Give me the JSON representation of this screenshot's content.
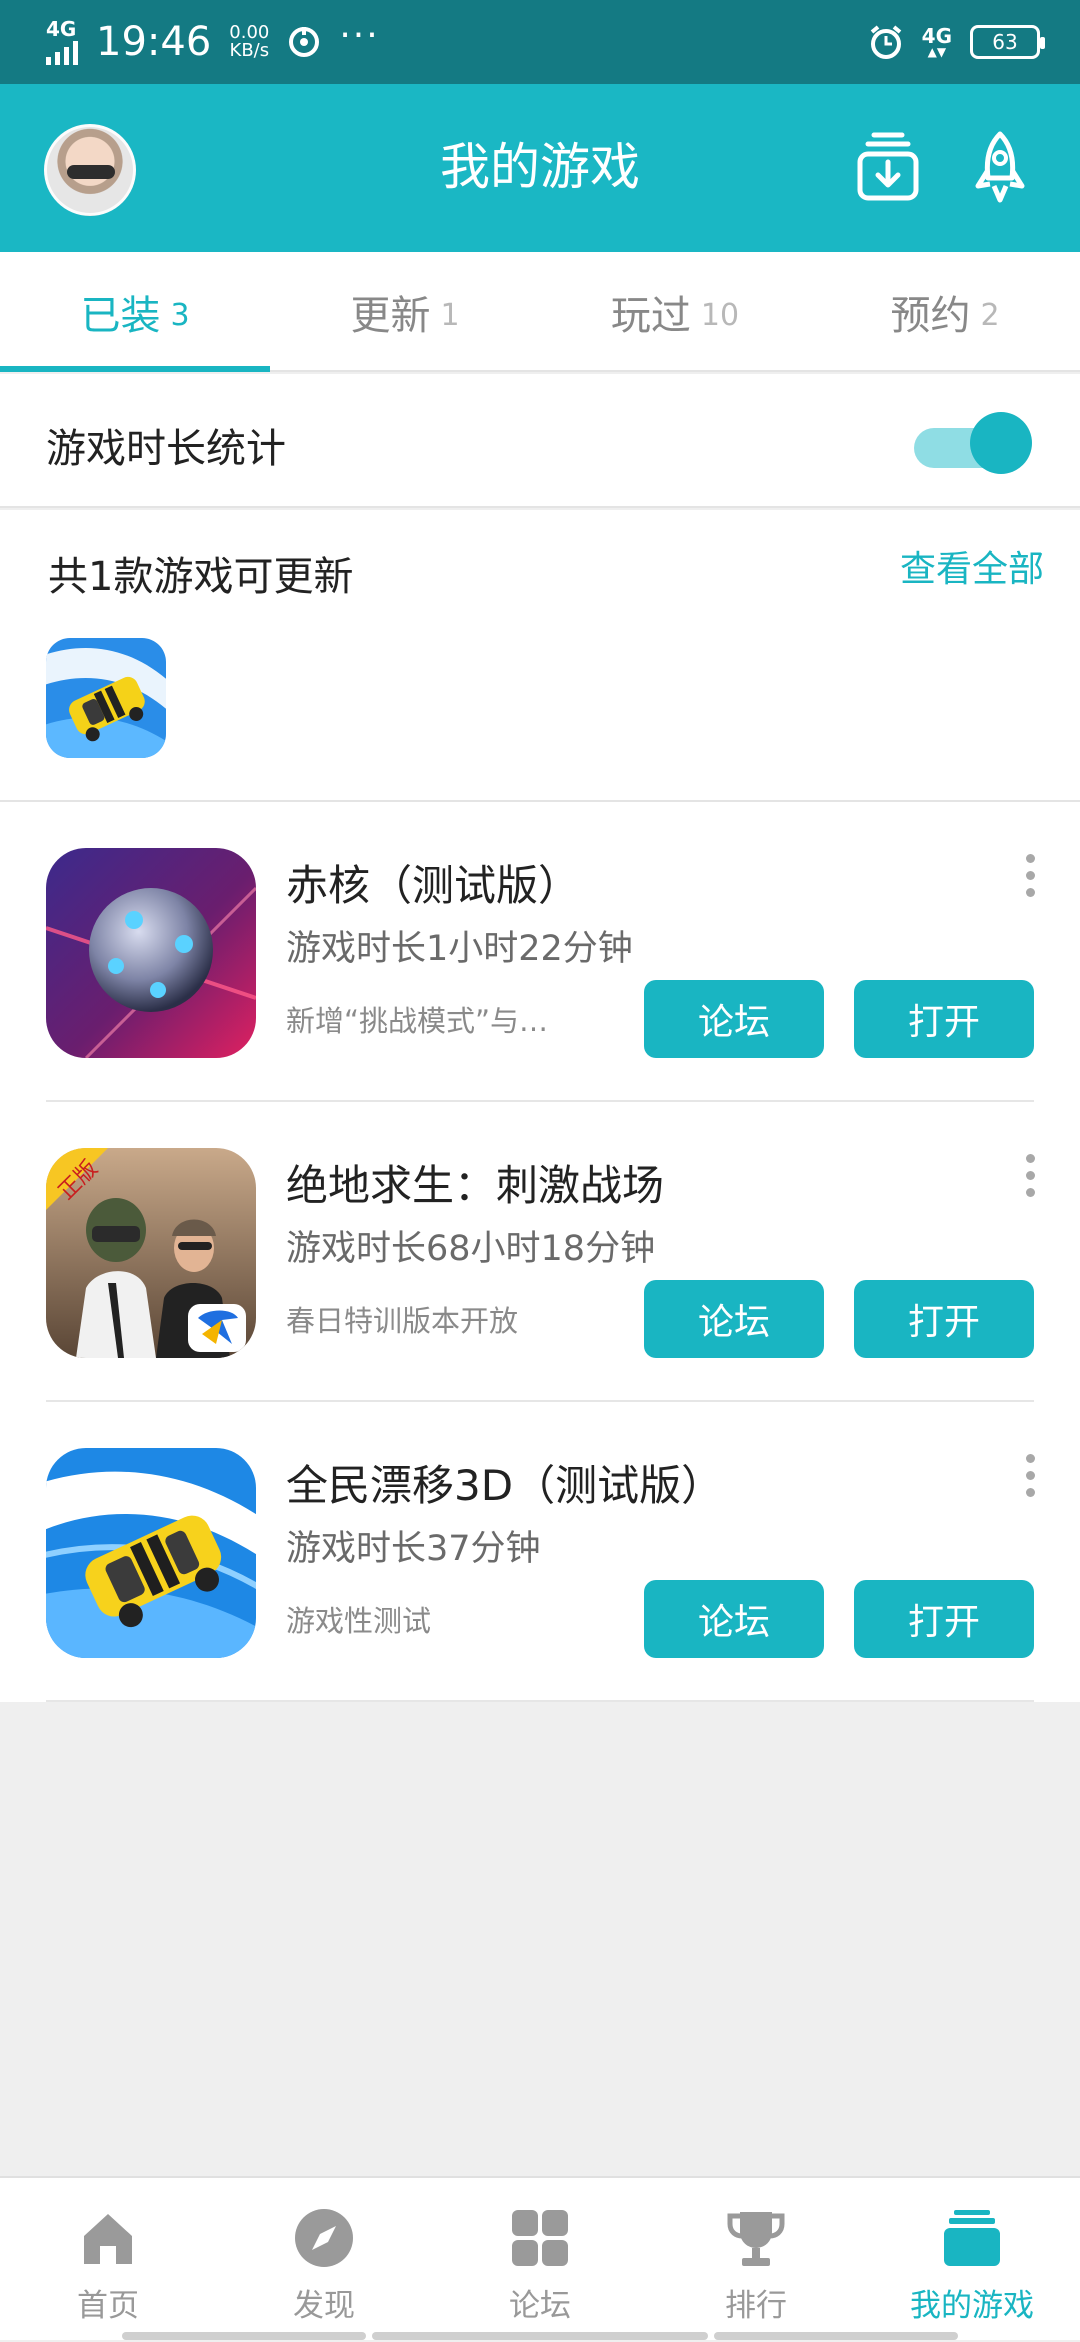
{
  "status_bar": {
    "network_left": "4G",
    "time": "19:46",
    "speed_value": "0.00",
    "speed_unit": "KB/s",
    "network_right": "4G",
    "battery": "63"
  },
  "header": {
    "title": "我的游戏"
  },
  "tabs": [
    {
      "label": "已装",
      "count": "3",
      "active": true
    },
    {
      "label": "更新",
      "count": "1",
      "active": false
    },
    {
      "label": "玩过",
      "count": "10",
      "active": false
    },
    {
      "label": "预约",
      "count": "2",
      "active": false
    }
  ],
  "stats": {
    "label": "游戏时长统计",
    "enabled": true
  },
  "updates": {
    "title": "共1款游戏可更新",
    "view_all": "查看全部"
  },
  "games": [
    {
      "name": "赤核（测试版）",
      "playtime": "游戏时长1小时22分钟",
      "note": "新增“挑战模式”与…",
      "forum_label": "论坛",
      "open_label": "打开"
    },
    {
      "name": "绝地求生：刺激战场",
      "playtime": "游戏时长68小时18分钟",
      "note": "春日特训版本开放",
      "forum_label": "论坛",
      "open_label": "打开",
      "badge": "正版"
    },
    {
      "name": "全民漂移3D（测试版）",
      "playtime": "游戏时长37分钟",
      "note": "游戏性测试",
      "forum_label": "论坛",
      "open_label": "打开"
    }
  ],
  "bottom_nav": [
    {
      "label": "首页",
      "icon": "home-icon",
      "active": false
    },
    {
      "label": "发现",
      "icon": "compass-icon",
      "active": false
    },
    {
      "label": "论坛",
      "icon": "grid-icon",
      "active": false
    },
    {
      "label": "排行",
      "icon": "trophy-icon",
      "active": false
    },
    {
      "label": "我的游戏",
      "icon": "stack-icon",
      "active": true
    }
  ],
  "colors": {
    "accent": "#19b5c2",
    "header_bg": "#1ab7c4",
    "status_bar_bg": "#147a83"
  }
}
